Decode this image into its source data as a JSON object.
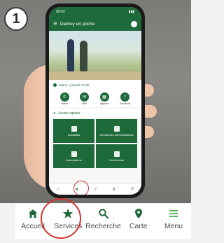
{
  "step": {
    "number": "1"
  },
  "phone": {
    "status_time": "09:43",
    "app_title": "Darboy en poche",
    "info_text": "Mairie • jusqu'à 17:00",
    "contacts": [
      {
        "label": "Mairie",
        "icon": "phone-icon"
      },
      {
        "label": "Mail",
        "icon": "mail-icon"
      },
      {
        "label": "Agenda",
        "icon": "calendar-icon"
      },
      {
        "label": "Facebook",
        "icon": "facebook-icon"
      }
    ],
    "section_title": "Accès rapides",
    "tiles": [
      {
        "label": "Actualités"
      },
      {
        "label": "Démarches administratives"
      },
      {
        "label": "Associations"
      },
      {
        "label": "Commerces"
      }
    ]
  },
  "bottom_nav": {
    "items": [
      {
        "label": "Accueil",
        "icon": "home-icon"
      },
      {
        "label": "Services",
        "icon": "star-icon"
      },
      {
        "label": "Recherche",
        "icon": "search-icon"
      },
      {
        "label": "Carte",
        "icon": "map-pin-icon"
      },
      {
        "label": "Menu",
        "icon": "menu-icon"
      }
    ]
  },
  "colors": {
    "brand": "#1e6a3b",
    "highlight": "#d8322f"
  }
}
